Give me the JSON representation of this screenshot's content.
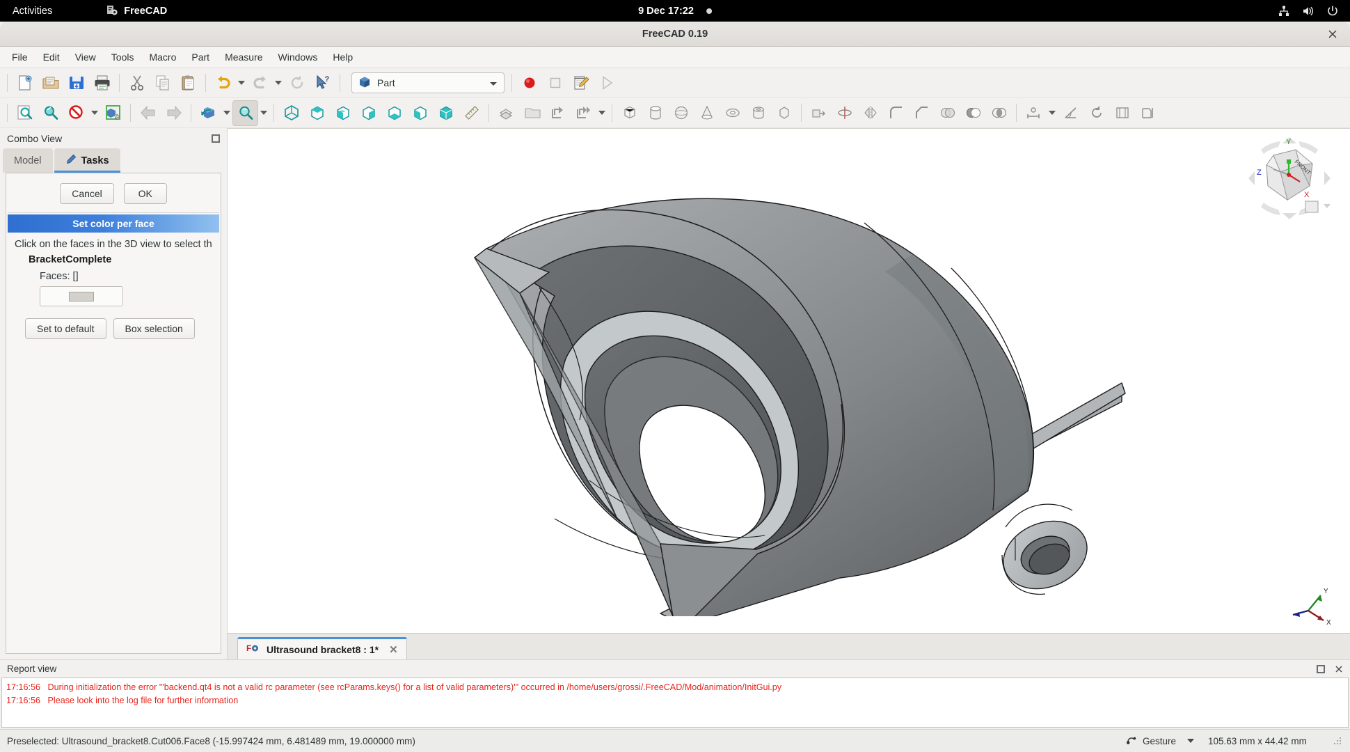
{
  "desktop": {
    "activities_label": "Activities",
    "app_name": "FreeCAD",
    "app_icon": "freecad-icon",
    "clock": "9 Dec  17:22",
    "tray": {
      "network_icon": "network-icon",
      "volume_icon": "volume-icon",
      "power_icon": "power-icon"
    }
  },
  "window": {
    "title": "FreeCAD 0.19",
    "close_icon": "close-icon"
  },
  "menubar": {
    "items": [
      {
        "label": "File"
      },
      {
        "label": "Edit"
      },
      {
        "label": "View"
      },
      {
        "label": "Tools"
      },
      {
        "label": "Macro"
      },
      {
        "label": "Part"
      },
      {
        "label": "Measure"
      },
      {
        "label": "Windows"
      },
      {
        "label": "Help"
      }
    ]
  },
  "toolbars": {
    "workbench": {
      "selected": "Part",
      "icon": "blue-cube-icon",
      "dropdown_icon": "chevron-down-icon"
    },
    "file_row_icons": [
      "new-document-icon",
      "open-folder-icon",
      "save-icon",
      "print-icon",
      "cut-icon",
      "copy-icon",
      "paste-icon",
      "undo-icon",
      "redo-icon",
      "refresh-icon",
      "whats-this-icon"
    ],
    "macro_row_icons": [
      "macro-record-icon",
      "macro-stop-icon",
      "macro-edit-icon",
      "macro-execute-icon"
    ],
    "view_row_icons": [
      "fit-all-icon",
      "fit-selection-icon",
      "draw-style-icon",
      "isometric-cube-icon",
      "back-arrow-icon",
      "forward-arrow-icon",
      "axonometric-icon",
      "zoom-box-icon",
      "front-view-icon",
      "top-view-icon",
      "right-view-icon",
      "rear-view-icon",
      "bottom-view-icon",
      "left-view-icon",
      "measure-ruler-icon"
    ],
    "part_row_icons": [
      "boolean-icon",
      "compound-icon",
      "export-icon",
      "import-icon",
      "box-icon",
      "cylinder-icon",
      "sphere-icon",
      "cone-icon",
      "torus-icon",
      "tube-icon",
      "primitives-icon"
    ]
  },
  "combo_view": {
    "panel_title": "Combo View",
    "float_icon": "float-panel-icon",
    "tabs": [
      {
        "label": "Model",
        "icon": "model-tab-icon",
        "selected": false
      },
      {
        "label": "Tasks",
        "icon": "pencil-icon",
        "selected": true
      }
    ],
    "dialog": {
      "cancel_label": "Cancel",
      "ok_label": "OK"
    },
    "task": {
      "title": "Set color per face",
      "instruction": "Click on the faces in the 3D view to select th",
      "object_name": "BracketComplete",
      "faces_label": "Faces:",
      "faces_value": "[]",
      "color_swatch_hex": "#d4d0cb",
      "set_default_label": "Set to default",
      "box_selection_label": "Box selection"
    }
  },
  "viewport": {
    "document_tab": {
      "label": "Ultrasound bracket8 : 1*",
      "icon": "freecad-doc-icon",
      "close_icon": "close-icon"
    },
    "navigation_cube": {
      "axis_x": "X",
      "axis_y": "Y",
      "axis_z": "Z",
      "face_label": "FRONT"
    },
    "axis_cross": {
      "x": "X",
      "y": "Y"
    },
    "model_colors": {
      "face_light": "#a9adb0",
      "face_mid": "#8e9295",
      "face_dark": "#6e7275",
      "edge": "#1a1a1a",
      "background": "#ffffff"
    }
  },
  "report_view": {
    "title": "Report view",
    "float_icon": "float-panel-icon",
    "close_icon": "close-icon",
    "messages": [
      {
        "time": "17:16:56",
        "text": "During initialization the error \"'backend.qt4 is not a valid rc parameter (see rcParams.keys() for a list of valid parameters)'\" occurred in /home/users/grossi/.FreeCAD/Mod/animation/InitGui.py",
        "color": "#e8231a"
      },
      {
        "time": "17:16:56",
        "text": "Please look into the log file for further information",
        "color": "#e8231a"
      }
    ]
  },
  "statusbar": {
    "preselection": "Preselected: Ultrasound_bracket8.Cut006.Face8 (-15.997424 mm, 6.481489 mm, 19.000000 mm)",
    "navigation_mode": "Gesture",
    "navigation_icon": "gesture-icon",
    "dropdown_icon": "chevron-down-icon",
    "dimensions": "105.63 mm x 44.42 mm",
    "resize_grip_icon": "resize-grip-icon"
  }
}
